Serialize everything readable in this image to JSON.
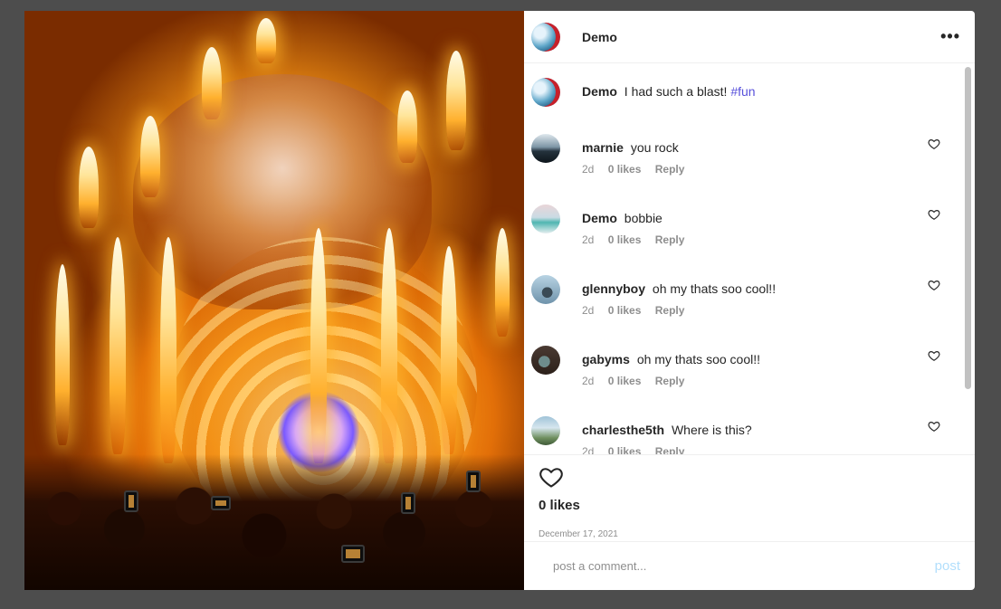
{
  "post": {
    "username": "Demo",
    "more_icon": "more-horizontal-icon",
    "photo_alt": "Concert stage with flame towers and crowd",
    "caption": {
      "username": "Demo",
      "text": "I had such a blast!",
      "hashtag": "#fun"
    },
    "likes_text": "0 likes",
    "date": "December 17, 2021"
  },
  "comments": [
    {
      "username": "marnie",
      "text": "you rock",
      "age": "2d",
      "likes": "0 likes",
      "reply": "Reply"
    },
    {
      "username": "Demo",
      "text": "bobbie",
      "age": "2d",
      "likes": "0 likes",
      "reply": "Reply"
    },
    {
      "username": "glennyboy",
      "text": "oh my thats soo cool!!",
      "age": "2d",
      "likes": "0 likes",
      "reply": "Reply"
    },
    {
      "username": "gabyms",
      "text": "oh my thats soo cool!!",
      "age": "2d",
      "likes": "0 likes",
      "reply": "Reply"
    },
    {
      "username": "charlesthe5th",
      "text": "Where is this?",
      "age": "2d",
      "likes": "0 likes",
      "reply": "Reply"
    }
  ],
  "composer": {
    "placeholder": "post a comment...",
    "post_label": "post"
  },
  "colors": {
    "hashtag": "#5851db",
    "post_disabled": "#b2dffc",
    "overlay": "#4d4d4d"
  }
}
